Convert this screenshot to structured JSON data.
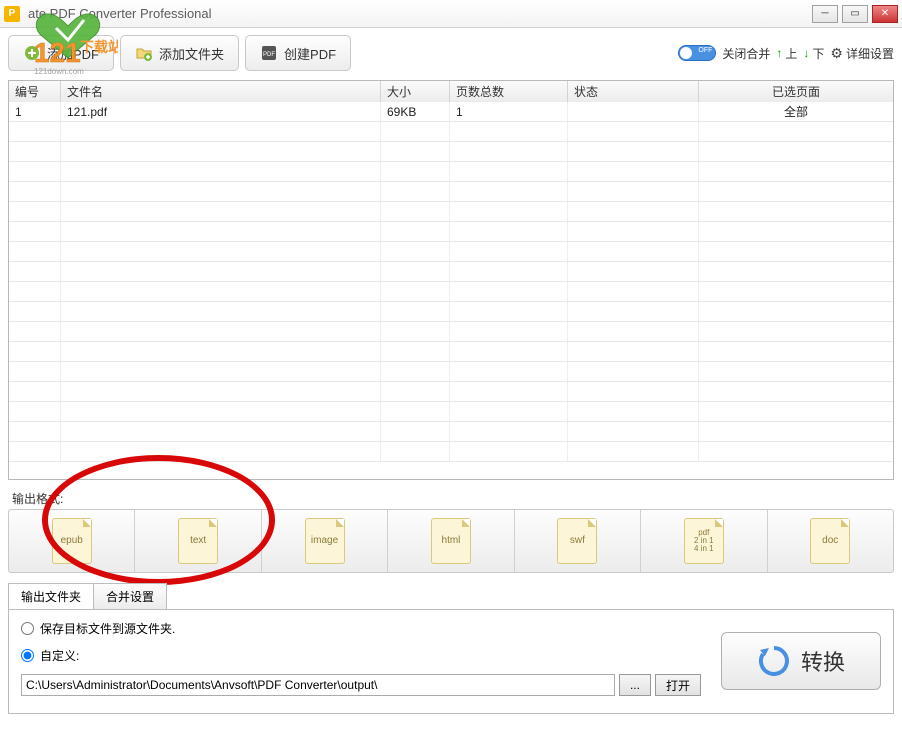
{
  "titlebar": {
    "title": "ate PDF Converter Professional"
  },
  "toolbar": {
    "add_pdf": "添加PDF",
    "add_folder": "添加文件夹",
    "create_pdf": "创建PDF",
    "merge_toggle": "关闭合并",
    "up": "上",
    "down": "下",
    "settings": "详细设置"
  },
  "table": {
    "headers": {
      "num": "编号",
      "name": "文件名",
      "size": "大小",
      "pages": "页数总数",
      "status": "状态",
      "selected": "已选页面"
    },
    "rows": [
      {
        "num": "1",
        "name": "121.pdf",
        "size": "69KB",
        "pages": "1",
        "status": "",
        "selected": "全部"
      }
    ]
  },
  "formats": {
    "label": "输出格式:",
    "items": [
      "epub",
      "text",
      "image",
      "html",
      "swf",
      "pdf\n2 in 1\n4 in 1",
      "doc"
    ]
  },
  "tabs": {
    "output_folder": "输出文件夹",
    "merge_settings": "合并设置"
  },
  "output": {
    "opt_source": "保存目标文件到源文件夹.",
    "opt_custom": "自定义:",
    "path": "C:\\Users\\Administrator\\Documents\\Anvsoft\\PDF Converter\\output\\",
    "browse": "...",
    "open": "打开"
  },
  "convert": {
    "label": "转换"
  },
  "watermark": {
    "brand": "121",
    "site": "121down.com"
  }
}
